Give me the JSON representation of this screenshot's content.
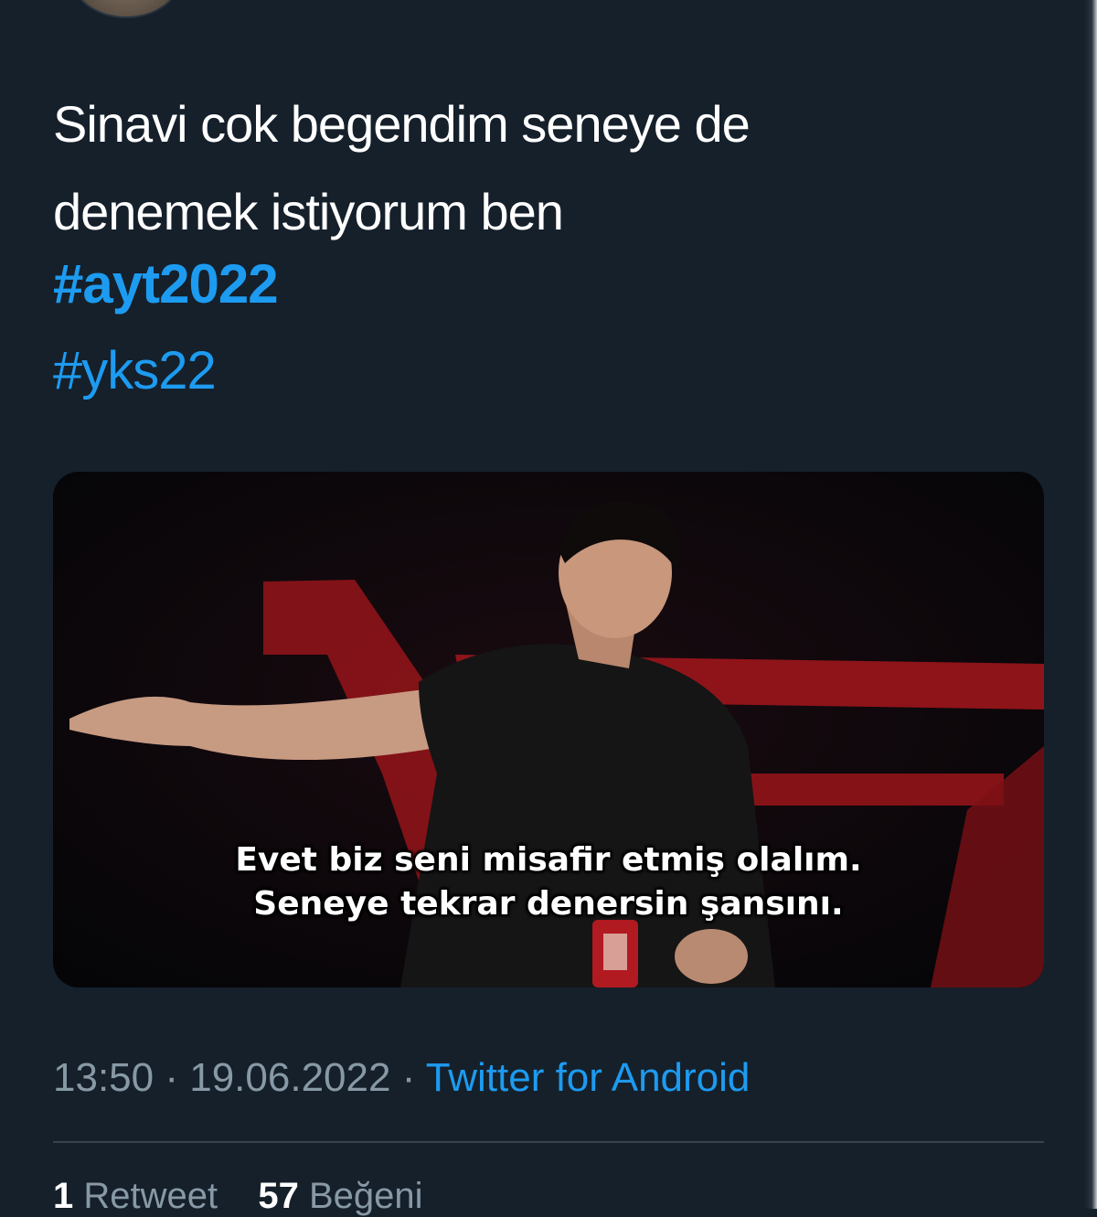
{
  "tweet": {
    "text_lines": [
      "Sinavi cok begendim seneye de",
      "denemek istiyorum ben"
    ],
    "hashtags": [
      "#ayt2022",
      "#yks22"
    ]
  },
  "media": {
    "caption_lines": [
      "Evet biz seni misafir etmiş olalım.",
      "Seneye tekrar denersin şansını."
    ]
  },
  "meta": {
    "time": "13:50",
    "separator": "·",
    "date": "19.06.2022",
    "source": "Twitter for Android"
  },
  "stats": {
    "retweets_count": "1",
    "retweets_label": "Retweet",
    "likes_count": "57",
    "likes_label": "Beğeni"
  },
  "colors": {
    "background": "#15202b",
    "link": "#1d9bf0",
    "secondary_text": "#8899a6"
  }
}
